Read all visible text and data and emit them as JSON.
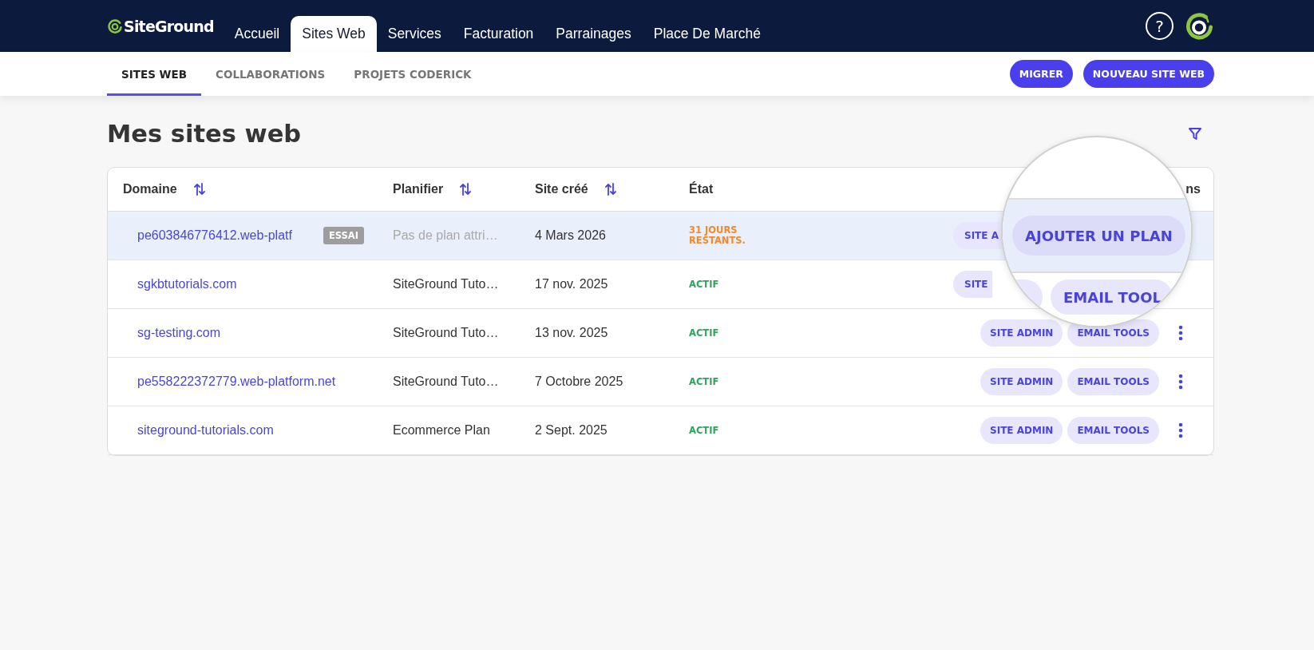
{
  "top_nav": {
    "logo_text": "SiteGround",
    "items": [
      {
        "label": "Accueil",
        "selected": false
      },
      {
        "label": "Sites Web",
        "selected": true
      },
      {
        "label": "Services",
        "selected": false
      },
      {
        "label": "Facturation",
        "selected": false
      },
      {
        "label": "Parrainages",
        "selected": false
      },
      {
        "label": "Place De Marché",
        "selected": false
      }
    ],
    "help": "?"
  },
  "sub_nav": {
    "tabs": [
      {
        "label": "SITES WEB",
        "selected": true
      },
      {
        "label": "COLLABORATIONS",
        "selected": false
      },
      {
        "label": "PROJETS CODERICK",
        "selected": false
      }
    ],
    "buttons": [
      {
        "label": "MIGRER"
      },
      {
        "label": "NOUVEAU SITE WEB"
      }
    ]
  },
  "page_title": "Mes sites web",
  "table": {
    "columns": [
      {
        "label": "Domaine",
        "sortable": true
      },
      {
        "label": "Planifier",
        "sortable": true
      },
      {
        "label": "Site créé",
        "sortable": true
      },
      {
        "label": "État",
        "sortable": false
      },
      {
        "label": "ns",
        "sortable": false
      }
    ],
    "rows": [
      {
        "highlighted": true,
        "domain": "pe603846776412.web-platf",
        "badge": "ESSAI",
        "plan": {
          "text": "Pas de plan attri…",
          "muted": true
        },
        "created": "4 Mars 2026",
        "status": {
          "text": "31 JOURS RESTANTS.",
          "color": "#f08b2d"
        },
        "actions": [
          {
            "kind": "button",
            "label": "SITE A"
          }
        ]
      },
      {
        "highlighted": false,
        "domain": "sgkbtutorials.com",
        "plan": {
          "text": "SiteGround Tuto…",
          "muted": false
        },
        "created": "17 nov. 2025",
        "status": {
          "text": "ACTIF",
          "color": "#2ea55a"
        },
        "actions": [
          {
            "kind": "button",
            "label": "SITE"
          }
        ]
      },
      {
        "highlighted": false,
        "domain": "sg-testing.com",
        "plan": {
          "text": "SiteGround Tuto…",
          "muted": false
        },
        "created": "13 nov. 2025",
        "status": {
          "text": "ACTIF",
          "color": "#2ea55a"
        },
        "actions": [
          {
            "kind": "button",
            "label": "SITE ADMIN"
          },
          {
            "kind": "button",
            "label": "EMAIL TOOLS"
          },
          {
            "kind": "menu"
          }
        ]
      },
      {
        "highlighted": false,
        "domain": "pe558222372779.web-platform.net",
        "plan": {
          "text": "SiteGround Tuto…",
          "muted": false
        },
        "created": "7 Octobre 2025",
        "status": {
          "text": "ACTIF",
          "color": "#2ea55a"
        },
        "actions": [
          {
            "kind": "button",
            "label": "SITE ADMIN"
          },
          {
            "kind": "button",
            "label": "EMAIL TOOLS"
          },
          {
            "kind": "menu"
          }
        ]
      },
      {
        "highlighted": false,
        "domain": "siteground-tutorials.com",
        "plan": {
          "text": "Ecommerce Plan",
          "muted": false
        },
        "created": "2 Sept. 2025",
        "status": {
          "text": "ACTIF",
          "color": "#2ea55a"
        },
        "actions": [
          {
            "kind": "button",
            "label": "SITE ADMIN"
          },
          {
            "kind": "button",
            "label": "EMAIL TOOLS"
          },
          {
            "kind": "menu"
          }
        ]
      }
    ]
  },
  "magnifier": {
    "rows": [
      {
        "highlighted": true,
        "actions": [
          {
            "kind": "button",
            "label": "AJOUTER UN PLAN"
          }
        ]
      },
      {
        "highlighted": false,
        "actions": [
          {
            "kind": "fragment"
          },
          {
            "kind": "button",
            "label": "EMAIL TOOL"
          }
        ]
      }
    ]
  }
}
